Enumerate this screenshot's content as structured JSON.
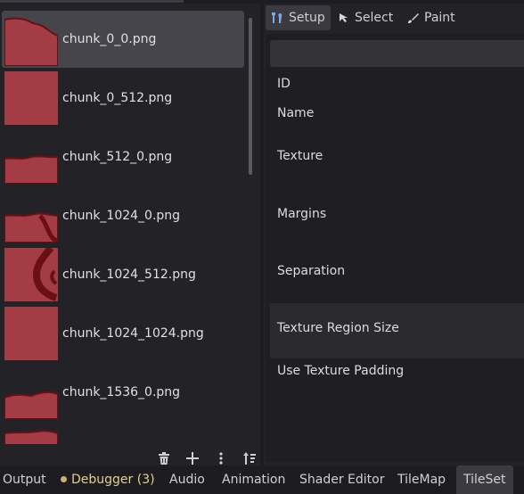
{
  "files": [
    {
      "name": "chunk_0_0.png",
      "selected": true
    },
    {
      "name": "chunk_0_512.png",
      "selected": false
    },
    {
      "name": "chunk_512_0.png",
      "selected": false
    },
    {
      "name": "chunk_1024_0.png",
      "selected": false
    },
    {
      "name": "chunk_1024_512.png",
      "selected": false
    },
    {
      "name": "chunk_1024_1024.png",
      "selected": false
    },
    {
      "name": "chunk_1536_0.png",
      "selected": false
    }
  ],
  "list_toolbar": {
    "icons": [
      "trash-icon",
      "plus-icon",
      "kebab-menu-icon",
      "sort-icon"
    ]
  },
  "tabs": [
    {
      "label": "Setup",
      "icon": "tools-icon",
      "active": true
    },
    {
      "label": "Select",
      "icon": "cursor-icon",
      "active": false
    },
    {
      "label": "Paint",
      "icon": "brush-icon",
      "active": false
    }
  ],
  "search": {
    "placeholder": ""
  },
  "properties": [
    {
      "label": "ID"
    },
    {
      "label": "Name"
    },
    {
      "label": "Texture"
    },
    {
      "label": "Margins"
    },
    {
      "label": "Separation"
    },
    {
      "label": "Texture Region Size"
    },
    {
      "label": "Use Texture Padding"
    }
  ],
  "bottom_tabs": [
    {
      "label": "Output"
    },
    {
      "label": "Debugger (3)",
      "status_color": "#c9b274"
    },
    {
      "label": "Audio"
    },
    {
      "label": "Animation"
    },
    {
      "label": "Shader Editor"
    },
    {
      "label": "TileMap"
    },
    {
      "label": "TileSet",
      "active": true
    }
  ],
  "colors": {
    "thumb_fill": "#a33c44",
    "thumb_stroke": "#6a0f14",
    "accent_icon": "#79a8e8"
  }
}
